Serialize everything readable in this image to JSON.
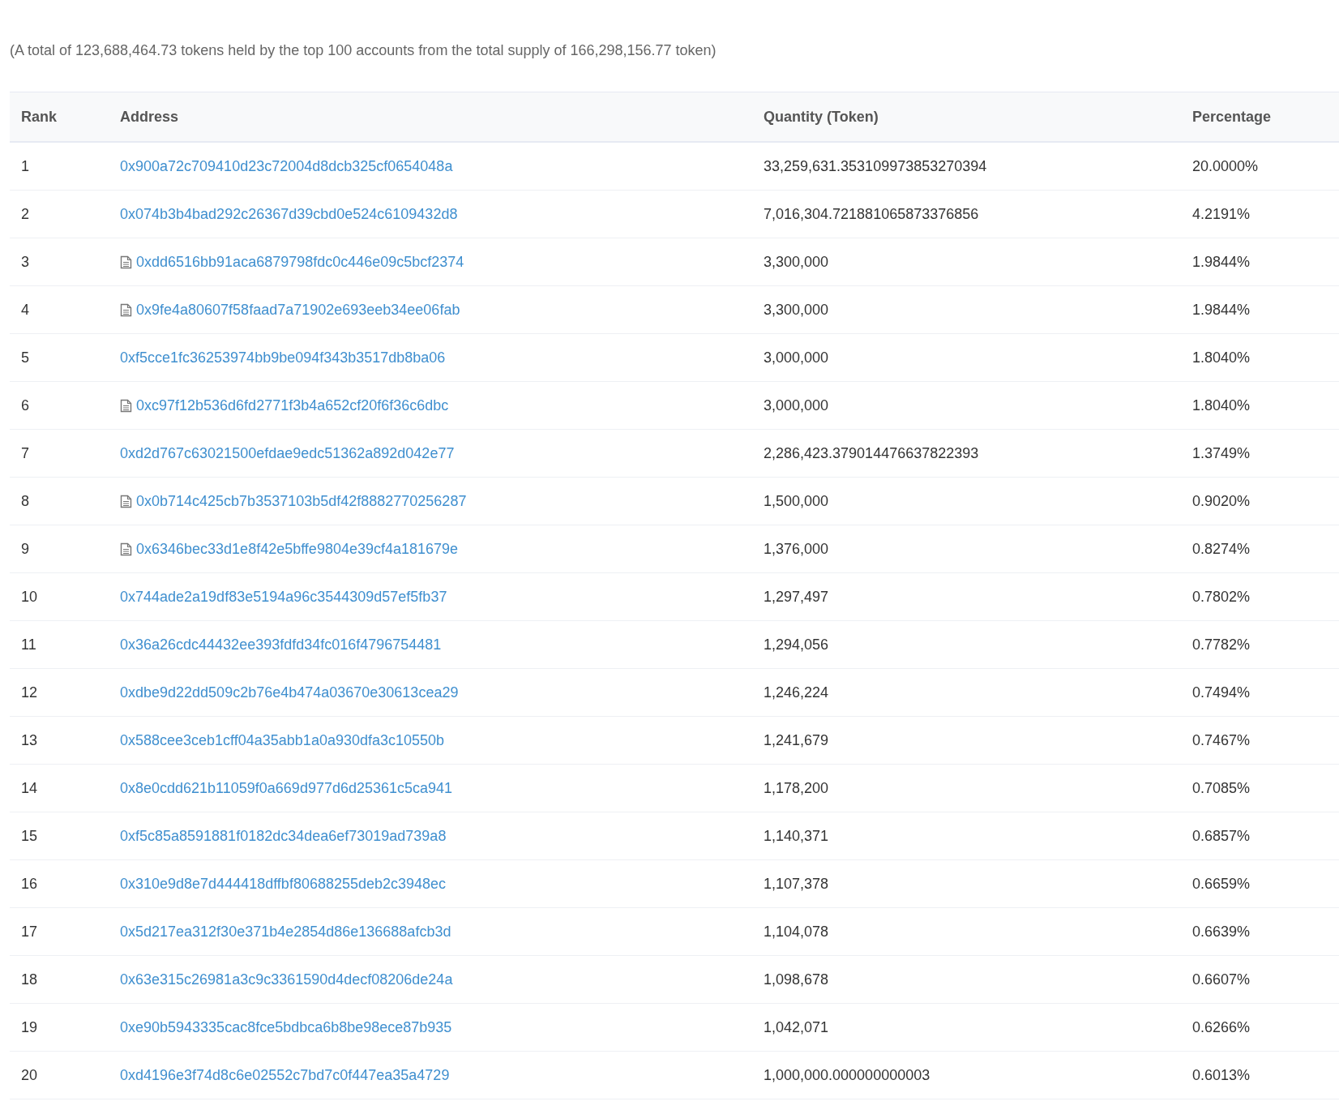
{
  "summary": "(A total of 123,688,464.73 tokens held by the top 100 accounts from the total supply of 166,298,156.77 token)",
  "table": {
    "columns": [
      "Rank",
      "Address",
      "Quantity (Token)",
      "Percentage"
    ],
    "rows": [
      {
        "rank": "1",
        "kind": "account",
        "address": "0x900a72c709410d23c72004d8dcb325cf0654048a",
        "quantity": "33,259,631.353109973853270394",
        "percentage": "20.0000%"
      },
      {
        "rank": "2",
        "kind": "account",
        "address": "0x074b3b4bad292c26367d39cbd0e524c6109432d8",
        "quantity": "7,016,304.721881065873376856",
        "percentage": "4.2191%"
      },
      {
        "rank": "3",
        "kind": "contract",
        "address": "0xdd6516bb91aca6879798fdc0c446e09c5bcf2374",
        "quantity": "3,300,000",
        "percentage": "1.9844%"
      },
      {
        "rank": "4",
        "kind": "contract",
        "address": "0x9fe4a80607f58faad7a71902e693eeb34ee06fab",
        "quantity": "3,300,000",
        "percentage": "1.9844%"
      },
      {
        "rank": "5",
        "kind": "account",
        "address": "0xf5cce1fc36253974bb9be094f343b3517db8ba06",
        "quantity": "3,000,000",
        "percentage": "1.8040%"
      },
      {
        "rank": "6",
        "kind": "contract",
        "address": "0xc97f12b536d6fd2771f3b4a652cf20f6f36c6dbc",
        "quantity": "3,000,000",
        "percentage": "1.8040%"
      },
      {
        "rank": "7",
        "kind": "account",
        "address": "0xd2d767c63021500efdae9edc51362a892d042e77",
        "quantity": "2,286,423.379014476637822393",
        "percentage": "1.3749%"
      },
      {
        "rank": "8",
        "kind": "contract",
        "address": "0x0b714c425cb7b3537103b5df42f8882770256287",
        "quantity": "1,500,000",
        "percentage": "0.9020%"
      },
      {
        "rank": "9",
        "kind": "contract",
        "address": "0x6346bec33d1e8f42e5bffe9804e39cf4a181679e",
        "quantity": "1,376,000",
        "percentage": "0.8274%"
      },
      {
        "rank": "10",
        "kind": "account",
        "address": "0x744ade2a19df83e5194a96c3544309d57ef5fb37",
        "quantity": "1,297,497",
        "percentage": "0.7802%"
      },
      {
        "rank": "11",
        "kind": "account",
        "address": "0x36a26cdc44432ee393fdfd34fc016f4796754481",
        "quantity": "1,294,056",
        "percentage": "0.7782%"
      },
      {
        "rank": "12",
        "kind": "account",
        "address": "0xdbe9d22dd509c2b76e4b474a03670e30613cea29",
        "quantity": "1,246,224",
        "percentage": "0.7494%"
      },
      {
        "rank": "13",
        "kind": "account",
        "address": "0x588cee3ceb1cff04a35abb1a0a930dfa3c10550b",
        "quantity": "1,241,679",
        "percentage": "0.7467%"
      },
      {
        "rank": "14",
        "kind": "account",
        "address": "0x8e0cdd621b11059f0a669d977d6d25361c5ca941",
        "quantity": "1,178,200",
        "percentage": "0.7085%"
      },
      {
        "rank": "15",
        "kind": "account",
        "address": "0xf5c85a8591881f0182dc34dea6ef73019ad739a8",
        "quantity": "1,140,371",
        "percentage": "0.6857%"
      },
      {
        "rank": "16",
        "kind": "account",
        "address": "0x310e9d8e7d444418dffbf80688255deb2c3948ec",
        "quantity": "1,107,378",
        "percentage": "0.6659%"
      },
      {
        "rank": "17",
        "kind": "account",
        "address": "0x5d217ea312f30e371b4e2854d86e136688afcb3d",
        "quantity": "1,104,078",
        "percentage": "0.6639%"
      },
      {
        "rank": "18",
        "kind": "account",
        "address": "0x63e315c26981a3c9c3361590d4decf08206de24a",
        "quantity": "1,098,678",
        "percentage": "0.6607%"
      },
      {
        "rank": "19",
        "kind": "account",
        "address": "0xe90b5943335cac8fce5bdbca6b8be98ece87b935",
        "quantity": "1,042,071",
        "percentage": "0.6266%"
      },
      {
        "rank": "20",
        "kind": "account",
        "address": "0xd4196e3f74d8c6e02552c7bd7c0f447ea35a4729",
        "quantity": "1,000,000.000000000003",
        "percentage": "0.6013%"
      }
    ]
  }
}
